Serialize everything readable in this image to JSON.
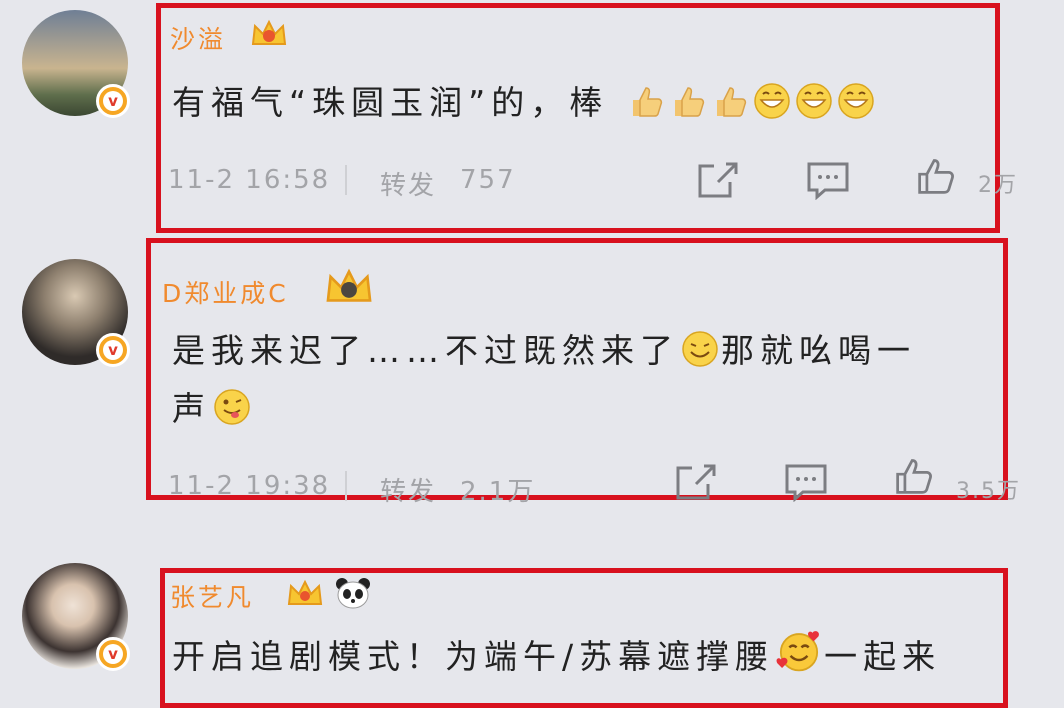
{
  "comments": [
    {
      "username": "沙溢",
      "text": "有福气“珠圆玉润”的，棒",
      "emojis": [
        "thumbs-up-icon",
        "thumbs-up-icon",
        "thumbs-up-icon",
        "grin-emoji",
        "grin-emoji",
        "grin-emoji"
      ],
      "date": "11-2 16:58",
      "repost_label": "转发",
      "repost_count": "757",
      "like_count": "2万"
    },
    {
      "username": "D郑业成C",
      "text_line1": "是我来迟了……不过既然来了",
      "text_line1_end": "那就吆喝一",
      "text_line2": "声",
      "date": "11-2 19:38",
      "repost_label": "转发",
      "repost_count": "2.1万",
      "like_count": "3.5万"
    },
    {
      "username": "张艺凡",
      "text_start": "开启追剧模式！为端午/苏幕遮撑腰",
      "text_end": "一起来"
    }
  ],
  "colors": {
    "highlight_border": "#d8111e",
    "username": "#f08a2e",
    "badge": "#f6a623"
  }
}
